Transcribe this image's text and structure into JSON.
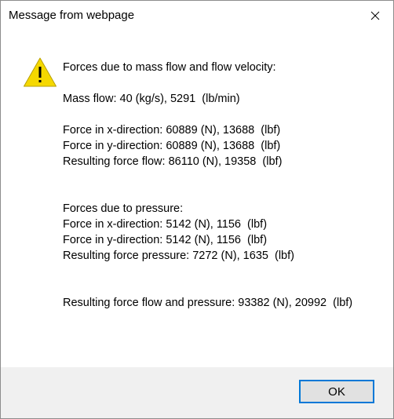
{
  "window": {
    "title": "Message from webpage",
    "close_icon": "close-icon"
  },
  "icon": {
    "type": "warning-icon",
    "glyph": "!",
    "color": "#f5d800"
  },
  "message": {
    "section1_heading": "Forces due to mass flow and flow velocity:",
    "mass_flow": "Mass flow: 40 (kg/s), 5291  (lb/min)",
    "force_x1": "Force in x-direction: 60889 (N), 13688  (lbf)",
    "force_y1": "Force in y-direction: 60889 (N), 13688  (lbf)",
    "resulting_flow": "Resulting force flow: 86110 (N), 19358  (lbf)",
    "section2_heading": "Forces due to pressure:",
    "force_x2": "Force in x-direction: 5142 (N), 1156  (lbf)",
    "force_y2": "Force in y-direction: 5142 (N), 1156  (lbf)",
    "resulting_pressure": "Resulting force pressure: 7272 (N), 1635  (lbf)",
    "resulting_total": "Resulting force flow and pressure: 93382 (N), 20992  (lbf)"
  },
  "buttons": {
    "ok_label": "OK",
    "accent": "#0078d7"
  }
}
